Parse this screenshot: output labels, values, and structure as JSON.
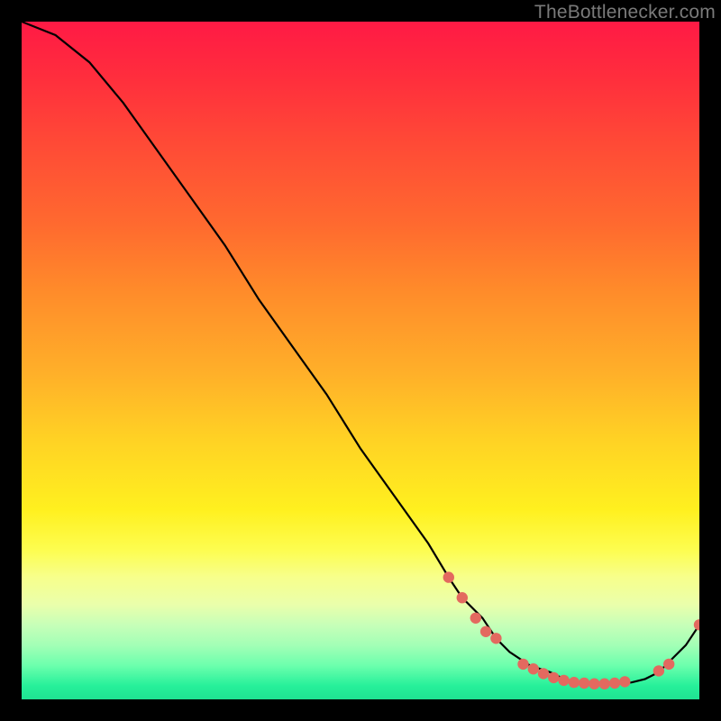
{
  "watermark": {
    "text": "TheBottlenecker.com"
  },
  "chart_data": {
    "type": "line",
    "title": "",
    "xlabel": "",
    "ylabel": "",
    "xlim": [
      0,
      100
    ],
    "ylim": [
      0,
      100
    ],
    "series": [
      {
        "name": "curve",
        "x": [
          0,
          5,
          10,
          15,
          20,
          25,
          30,
          35,
          40,
          45,
          50,
          55,
          60,
          63,
          65,
          68,
          70,
          72,
          75,
          78,
          80,
          82,
          85,
          88,
          90,
          92,
          94,
          96,
          98,
          100
        ],
        "y": [
          100,
          98,
          94,
          88,
          81,
          74,
          67,
          59,
          52,
          45,
          37,
          30,
          23,
          18,
          15,
          12,
          9,
          7,
          5,
          4,
          3,
          2.5,
          2.3,
          2.3,
          2.5,
          3,
          4,
          6,
          8,
          11
        ]
      }
    ],
    "highlight_points": [
      {
        "x": 63,
        "y": 18
      },
      {
        "x": 65,
        "y": 15
      },
      {
        "x": 67,
        "y": 12
      },
      {
        "x": 68.5,
        "y": 10
      },
      {
        "x": 70,
        "y": 9
      },
      {
        "x": 74,
        "y": 5.2
      },
      {
        "x": 75.5,
        "y": 4.5
      },
      {
        "x": 77,
        "y": 3.8
      },
      {
        "x": 78.5,
        "y": 3.2
      },
      {
        "x": 80,
        "y": 2.8
      },
      {
        "x": 81.5,
        "y": 2.5
      },
      {
        "x": 83,
        "y": 2.4
      },
      {
        "x": 84.5,
        "y": 2.3
      },
      {
        "x": 86,
        "y": 2.3
      },
      {
        "x": 87.5,
        "y": 2.4
      },
      {
        "x": 89,
        "y": 2.6
      },
      {
        "x": 94,
        "y": 4.2
      },
      {
        "x": 95.5,
        "y": 5.2
      },
      {
        "x": 100,
        "y": 11
      }
    ],
    "highlight_color": "#e3695f",
    "curve_color": "#000000"
  }
}
